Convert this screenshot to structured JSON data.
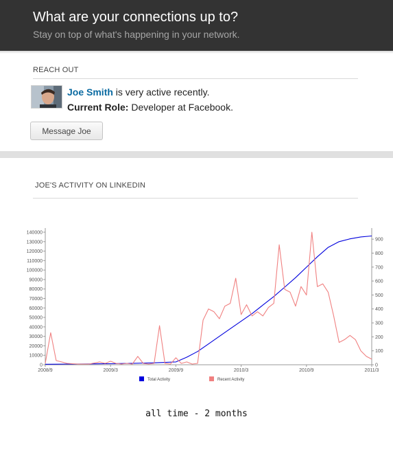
{
  "header": {
    "title": "What are your connections up to?",
    "subtitle": "Stay on top of what's happening in your network."
  },
  "reach_out": {
    "section_label": "REACH OUT",
    "person_name": "Joe Smith",
    "activity_text": " is very active recently.",
    "role_label": "Current Role:",
    "role_value": " Developer at Facebook.",
    "message_button": "Message Joe"
  },
  "activity": {
    "section_label": "JOE'S ACTIVITY ON LINKEDIN",
    "timescale_label": "all time - 2 months"
  },
  "colors": {
    "header_bg": "#333333",
    "link": "#0a6aa1",
    "total_series": "#0000dd",
    "recent_series": "#f08080"
  },
  "chart_data": {
    "type": "line",
    "x_tick_labels": [
      "2008/9",
      "2009/3",
      "2009/9",
      "2010/3",
      "2010/9",
      "2011/3"
    ],
    "x_range": [
      "2008/9",
      "2011/3"
    ],
    "left_y": {
      "ylim": [
        0,
        140000
      ],
      "ticks": [
        0,
        10000,
        20000,
        30000,
        40000,
        50000,
        60000,
        70000,
        80000,
        90000,
        100000,
        110000,
        120000,
        130000,
        140000
      ]
    },
    "right_y": {
      "ylim": [
        0,
        950
      ],
      "ticks": [
        0,
        100,
        200,
        300,
        400,
        500,
        600,
        700,
        800,
        900
      ]
    },
    "grid": false,
    "legend_position": "bottom",
    "series": [
      {
        "name": "Total Activity",
        "axis": "left",
        "x": [
          0,
          1,
          2,
          3,
          4,
          5,
          6,
          7,
          8,
          9,
          10,
          11,
          12,
          13,
          14,
          15,
          16,
          17,
          18,
          19,
          20,
          21,
          22,
          23,
          24,
          25,
          26,
          27,
          28,
          29,
          30
        ],
        "values": [
          500,
          600,
          700,
          800,
          900,
          1000,
          1100,
          1300,
          1500,
          1800,
          2000,
          2500,
          3000,
          8000,
          14000,
          22000,
          30000,
          38000,
          46000,
          54000,
          63000,
          72000,
          82000,
          92000,
          103000,
          114000,
          124000,
          130000,
          133000,
          135000,
          136000
        ]
      },
      {
        "name": "Recent Activity",
        "axis": "right",
        "x": [
          0,
          0.5,
          1,
          1.5,
          2,
          3,
          4,
          5,
          5.5,
          6,
          6.5,
          7,
          7.5,
          8,
          8.5,
          9,
          9.5,
          10,
          10.5,
          11,
          11.5,
          12,
          12.5,
          13,
          13.5,
          14,
          14.5,
          15,
          15.5,
          16,
          16.5,
          17,
          17.5,
          18,
          18.5,
          19,
          19.5,
          20,
          20.5,
          21,
          21.5,
          22,
          22.5,
          23,
          23.5,
          24,
          24.5,
          25,
          25.5,
          26,
          26.5,
          27,
          27.5,
          28,
          28.5,
          29,
          29.5,
          30
        ],
        "values": [
          10,
          230,
          30,
          20,
          10,
          5,
          5,
          20,
          10,
          25,
          10,
          5,
          10,
          5,
          60,
          10,
          5,
          10,
          280,
          10,
          5,
          50,
          10,
          20,
          5,
          10,
          320,
          400,
          380,
          330,
          420,
          440,
          620,
          360,
          430,
          350,
          380,
          350,
          410,
          440,
          860,
          540,
          520,
          420,
          560,
          500,
          950,
          560,
          580,
          520,
          350,
          160,
          180,
          210,
          180,
          100,
          60,
          40
        ]
      }
    ]
  }
}
